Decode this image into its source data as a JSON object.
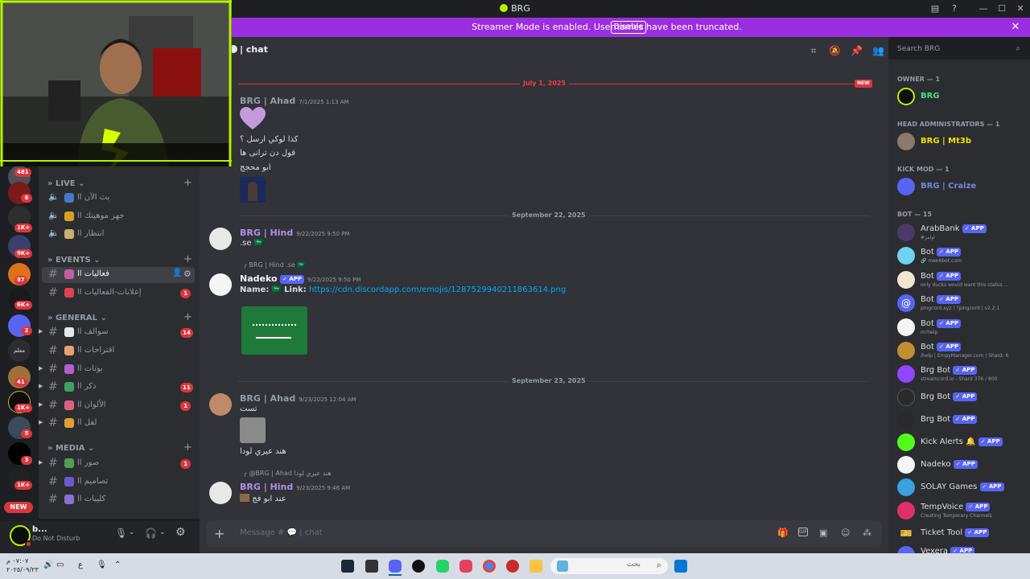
{
  "window": {
    "title": "BRG",
    "min": "—",
    "max": "☐",
    "close": "✕"
  },
  "banner": {
    "text": "Streamer Mode is enabled. Usernames have been truncated.",
    "disable": "Disable",
    "close": "✕"
  },
  "guild_badges": {
    "g0": "481",
    "g1": "6",
    "g2": "1K+",
    "g3": "9K+",
    "g4": "87",
    "g5": "6K+",
    "g6": "2",
    "g7": "معلم",
    "g8": "41",
    "g9": "1K+",
    "g10": "5",
    "g11": "3",
    "g12": "1K+",
    "new": "NEW"
  },
  "channel_list": {
    "live": {
      "label": "LIVE",
      "items": [
        {
          "name": "بث الآن اا"
        },
        {
          "name": "جهز موهيتك اا"
        },
        {
          "name": "انتظار اا"
        }
      ]
    },
    "events": {
      "label": "EVENTS",
      "items": [
        {
          "name": "فعاليات اا"
        },
        {
          "name": "إعلانات-الفعاليات اا",
          "badge": "1"
        }
      ]
    },
    "general": {
      "label": "GENERAL",
      "items": [
        {
          "name": "سوالف اا",
          "badge": "14"
        },
        {
          "name": "اقتراحات اا"
        },
        {
          "name": "بوتات اا"
        },
        {
          "name": "ذكر اا",
          "badge": "11"
        },
        {
          "name": "الألوان اا",
          "badge": "1"
        },
        {
          "name": "لفل اا"
        }
      ]
    },
    "media": {
      "label": "MEDIA",
      "items": [
        {
          "name": "صور اا",
          "badge": "1"
        },
        {
          "name": "تصاميم اا"
        },
        {
          "name": "كليبات اا"
        }
      ]
    }
  },
  "user": {
    "name": "b...",
    "status": "Do Not Disturb"
  },
  "chat": {
    "channel": "| chat",
    "search_placeholder": "Search BRG",
    "composer_placeholder": "Message # 💬 | chat",
    "new_label": "NEW"
  },
  "dates": {
    "d1": "July 1, 2025",
    "d2": "September 22, 2025",
    "d3": "September 23, 2025"
  },
  "messages": {
    "m1": {
      "author": "BRG | Ahad",
      "time": "7/1/2025 1:13 AM",
      "l1": "كذا لوكي ارسل ؟",
      "l2": "قول دن ترانی ها",
      "l3": "ابو محجج"
    },
    "m2": {
      "author": "BRG | Hind",
      "time": "9/22/2025 9:50 PM",
      "text": ".se 🇸🇦"
    },
    "m3": {
      "reply": "BRG | Hind .se 🇸🇦",
      "author": "Nadeko",
      "app": "APP",
      "time": "9/22/2025 9:50 PM",
      "name_label": "Name:",
      "link_label": "Link:",
      "link": "https://cdn.discordapp.com/emojis/1287529940211863614.png"
    },
    "m4": {
      "author": "BRG | Ahad",
      "time": "9/23/2025 12:04 AM",
      "l1": "تست",
      "l2": "هند عيري لودا"
    },
    "m5": {
      "reply": "@BRG | Ahad هند عيري لودا",
      "author": "BRG | Hind",
      "time": "9/23/2025 9:46 AM",
      "l1": "عند ابو فج"
    }
  },
  "members": {
    "owner_cat": "OWNER — 1",
    "owner": "BRG",
    "head_cat": "Head administrators — 1",
    "head": "BRG | Mt3b",
    "kick_cat": "KICK MOD — 1",
    "kick": "BRG | Craize",
    "bot_cat": "Bot — 15",
    "bots": [
      {
        "name": "ArabBank",
        "status": "#اوامر"
      },
      {
        "name": "Bot",
        "status": "🔗 mee6bot.com"
      },
      {
        "name": "Bot",
        "status": "only ducks would want this status ..."
      },
      {
        "name": "Bot",
        "status": "pingcord.xyz | ?pingcord | v2.2.1"
      },
      {
        "name": "Bot",
        "status": "m!help"
      },
      {
        "name": "Bot",
        "status": "/help | EmpyManager.com | Shard: 6"
      },
      {
        "name": "Brg Bot",
        "status": "streamcord.io - Shard 376 / 800"
      },
      {
        "name": "Brg Bot",
        "status": ""
      },
      {
        "name": "Brg Bot",
        "status": ""
      },
      {
        "name": "Kick Alerts 🔔",
        "status": ""
      },
      {
        "name": "Nadeko",
        "status": ""
      },
      {
        "name": "SOLAY Games",
        "status": ""
      },
      {
        "name": "TempVoice",
        "status": "Creating Temporary Channels"
      },
      {
        "name": "Ticket Tool",
        "status": ""
      },
      {
        "name": "Vexera",
        "status": ""
      }
    ],
    "app": "APP"
  },
  "taskbar": {
    "time": "٠٧:٠٧ م",
    "date": "٢٠٢٥/٠٩/٢٣",
    "search_placeholder": "بحث",
    "lang": "ع"
  },
  "colors": {
    "accent": "#5865f2",
    "banner": "#9b2fe0",
    "owner": "#4ade80",
    "head": "#f0e000",
    "brg": "#b48ee8",
    "danger": "#da373c"
  }
}
